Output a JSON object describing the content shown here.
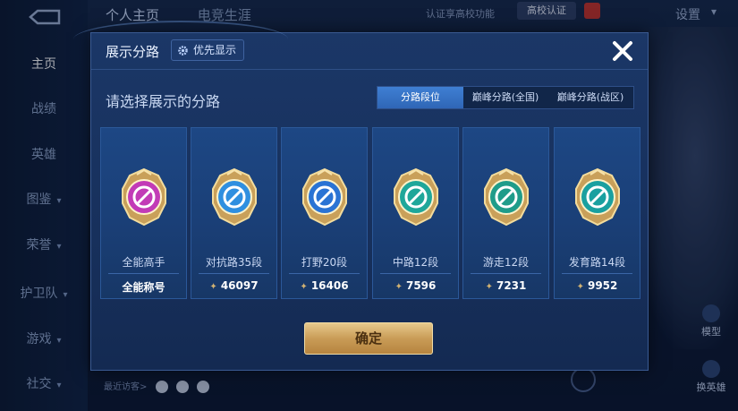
{
  "background": {
    "top_tabs": [
      "个人主页",
      "电竞生涯"
    ],
    "hint": "认证享高校功能",
    "school_button": "高校认证",
    "settings": "设置",
    "sidebar": [
      {
        "label": "主页",
        "active": true,
        "chev": false
      },
      {
        "label": "战绩",
        "active": false,
        "chev": false
      },
      {
        "label": "英雄",
        "active": false,
        "chev": false
      },
      {
        "label": "图鉴",
        "active": false,
        "chev": true
      },
      {
        "label": "荣誉",
        "active": false,
        "chev": true
      },
      {
        "label": "护卫队",
        "active": false,
        "chev": true
      },
      {
        "label": "游戏",
        "active": false,
        "chev": true
      },
      {
        "label": "社交",
        "active": false,
        "chev": true
      }
    ],
    "model_label": "模型",
    "swap_hero_label": "换英雄",
    "recent_visitors": "最近访客>"
  },
  "modal": {
    "title": "展示分路",
    "priority_button": "优先显示",
    "section_title": "请选择展示的分路",
    "segments": [
      {
        "label": "分路段位",
        "active": true
      },
      {
        "label": "巅峰分路(全国)",
        "active": false
      },
      {
        "label": "巅峰分路(战区)",
        "active": false
      }
    ],
    "cards": [
      {
        "label": "全能高手",
        "value": "全能称号",
        "show_diamond": false,
        "emblem_color": "#c23bb7",
        "icon": "allround-icon"
      },
      {
        "label": "对抗路35段",
        "value": "46097",
        "show_diamond": true,
        "emblem_color": "#2f8fe0",
        "icon": "clash-lane-icon"
      },
      {
        "label": "打野20段",
        "value": "16406",
        "show_diamond": true,
        "emblem_color": "#2a73d4",
        "icon": "jungle-icon"
      },
      {
        "label": "中路12段",
        "value": "7596",
        "show_diamond": true,
        "emblem_color": "#1fa79a",
        "icon": "mid-lane-icon"
      },
      {
        "label": "游走12段",
        "value": "7231",
        "show_diamond": true,
        "emblem_color": "#1f9c8a",
        "icon": "roam-icon"
      },
      {
        "label": "发育路14段",
        "value": "9952",
        "show_diamond": true,
        "emblem_color": "#1aa0a0",
        "icon": "farm-lane-icon"
      }
    ],
    "confirm": "确定"
  }
}
